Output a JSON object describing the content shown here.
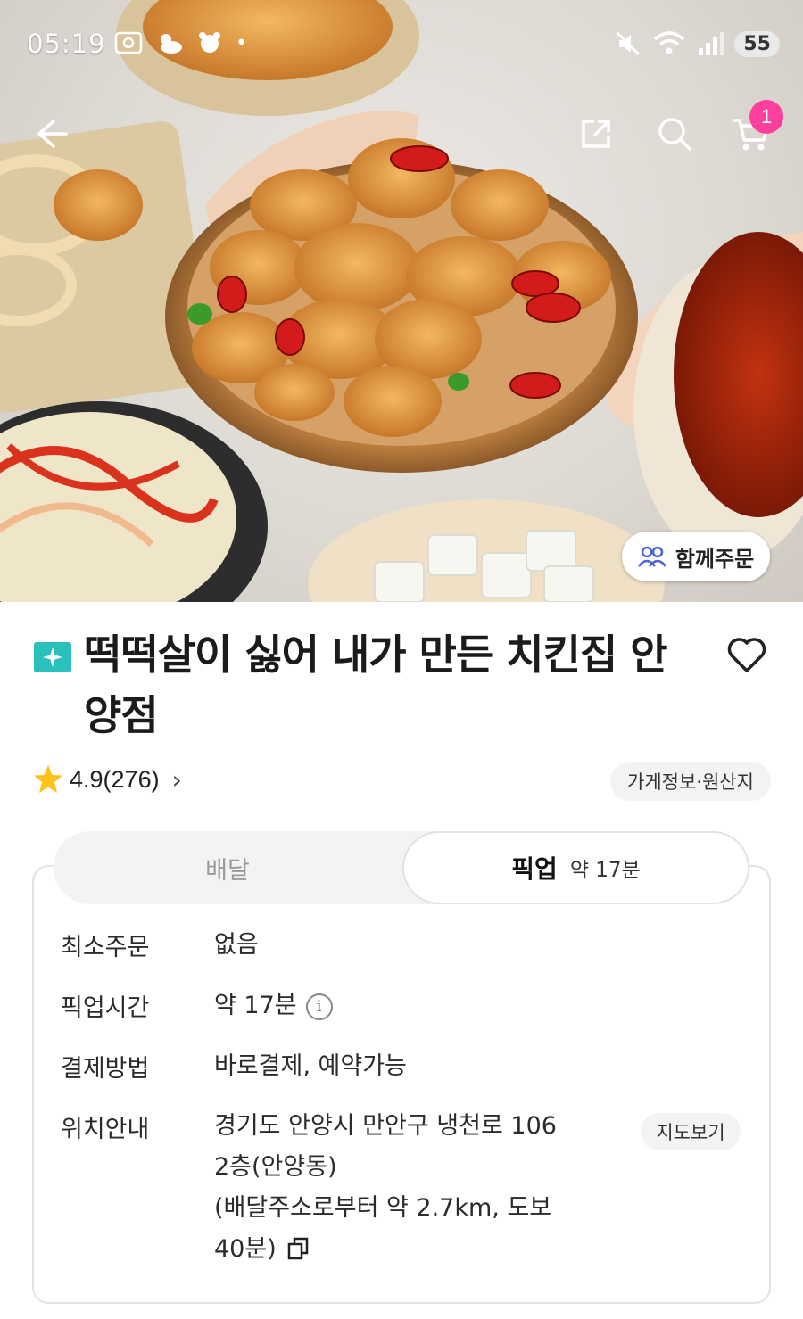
{
  "status_bar": {
    "time": "05:19",
    "battery": "55"
  },
  "nav": {
    "cart_count": "1"
  },
  "hero": {
    "group_order_label": "함께주문"
  },
  "store": {
    "name": "떡떡살이 싫어 내가 만든 치킨집 안양점",
    "rating": "4.9",
    "review_count": "(276)",
    "info_chip": "가게정보·원산지"
  },
  "tabs": {
    "delivery_label": "배달",
    "pickup_label": "픽업",
    "pickup_time": "약 17분"
  },
  "info": {
    "min_order_label": "최소주문",
    "min_order_value": "없음",
    "pickup_time_label": "픽업시간",
    "pickup_time_value": "약 17분",
    "payment_label": "결제방법",
    "payment_value": "바로결제, 예약가능",
    "location_label": "위치안내",
    "location_line1": "경기도 안양시 만안구 냉천로 106",
    "location_line2": "2층(안양동)",
    "location_line3": "(배달주소로부터 약 2.7km, 도보",
    "location_line4": "40분)",
    "map_button": "지도보기"
  },
  "colors": {
    "brand": "#2ac1bc",
    "badge": "#ff3f9e",
    "star": "#ffc21a"
  }
}
